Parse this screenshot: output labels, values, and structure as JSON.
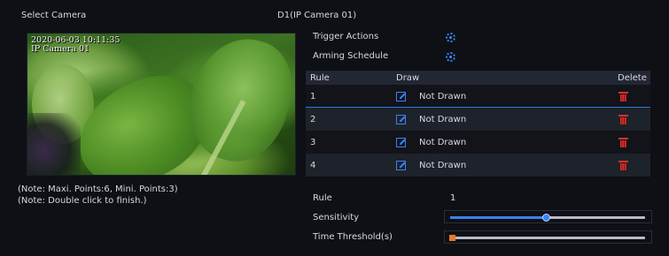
{
  "header": {
    "select_camera_label": "Select Camera",
    "camera_name": "D1(IP Camera 01)"
  },
  "preview": {
    "osd_datetime": "2020-06-03 10:11:35",
    "osd_channel": "IP Camera 01"
  },
  "options": {
    "trigger_actions_label": "Trigger Actions",
    "trigger_actions_icon": "gear-icon",
    "arming_schedule_label": "Arming Schedule",
    "arming_schedule_icon": "gear-icon"
  },
  "rules_table": {
    "columns": [
      "Rule",
      "Draw",
      "Delete"
    ],
    "rows": [
      {
        "rule": "1",
        "status": "Not Drawn"
      },
      {
        "rule": "2",
        "status": "Not Drawn"
      },
      {
        "rule": "3",
        "status": "Not Drawn"
      },
      {
        "rule": "4",
        "status": "Not Drawn"
      }
    ],
    "selected_row": 1
  },
  "notes": {
    "line1": "(Note: Maxi. Points:6, Mini. Points:3)",
    "line2": "(Note: Double click to finish.)"
  },
  "settings": {
    "rule_label": "Rule",
    "rule_value": "1",
    "sensitivity_label": "Sensitivity",
    "sensitivity_level": 0.49,
    "time_threshold_label": "Time Threshold(s)",
    "time_threshold_level": 0.0
  },
  "colors": {
    "accent": "#3b82f6",
    "delete": "#e0302a",
    "threshold_thumb": "#e8792a"
  }
}
